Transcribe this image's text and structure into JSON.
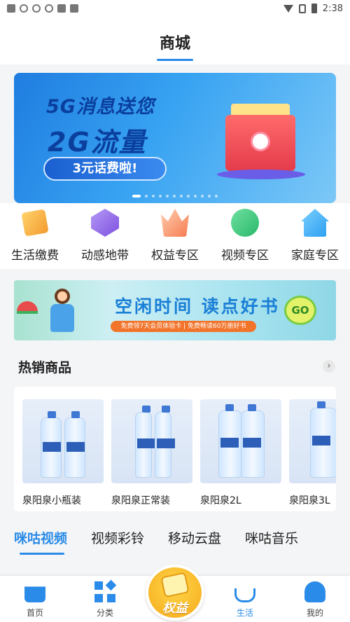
{
  "status_bar": {
    "time": "2:38"
  },
  "header": {
    "title": "商城"
  },
  "main_banner": {
    "line1": "5G消息送您",
    "line2": "2G流量",
    "pill": "3元话费啦!",
    "page_count": 12,
    "active_page": 1
  },
  "categories": [
    {
      "label": "生活缴费",
      "icon": "bill-payment-icon"
    },
    {
      "label": "动感地带",
      "icon": "mzone-icon"
    },
    {
      "label": "权益专区",
      "icon": "vip-crown-icon"
    },
    {
      "label": "视频专区",
      "icon": "video-icon"
    },
    {
      "label": "家庭专区",
      "icon": "home-icon"
    }
  ],
  "promo_banner": {
    "title": "空闲时间 读点好书",
    "subtitle": "免费领7天会员体验卡 | 免费畅读60万册好书",
    "go": "GO"
  },
  "hot_products": {
    "title": "热销商品",
    "items": [
      {
        "name": "泉阳泉小瓶装"
      },
      {
        "name": "泉阳泉正常装"
      },
      {
        "name": "泉阳泉2L"
      },
      {
        "name": "泉阳泉3L"
      }
    ]
  },
  "tabs": [
    {
      "label": "咪咕视频",
      "active": true
    },
    {
      "label": "视频彩铃",
      "active": false
    },
    {
      "label": "移动云盘",
      "active": false
    },
    {
      "label": "咪咕音乐",
      "active": false
    }
  ],
  "bottom_nav": {
    "items": [
      {
        "label": "首页",
        "icon": "store-icon"
      },
      {
        "label": "分类",
        "icon": "category-icon"
      },
      {
        "label": "生活",
        "icon": "coffee-cup-icon",
        "active": true
      },
      {
        "label": "我的",
        "icon": "user-icon"
      }
    ],
    "center": {
      "label": "权益",
      "icon": "coupon-icon"
    }
  },
  "colors": {
    "accent": "#2a8be8",
    "banner_text": "#0b3f9e"
  }
}
